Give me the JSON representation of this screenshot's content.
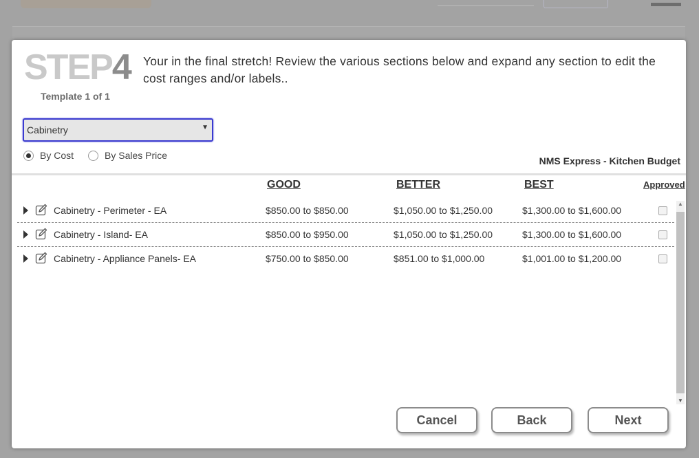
{
  "step": {
    "label": "STEP",
    "number": "4"
  },
  "template_info": "Template 1  of 1",
  "instructions": "Your in the final stretch!  Review the various sections below and expand any section to edit the cost ranges and/or labels..",
  "section_select": {
    "value": "Cabinetry"
  },
  "pricing_mode": [
    {
      "label": "By Cost",
      "selected": true
    },
    {
      "label": "By Sales Price",
      "selected": false
    }
  ],
  "budget_name": "NMS Express - Kitchen Budget",
  "columns": {
    "good": "GOOD",
    "better": "BETTER",
    "best": "BEST",
    "approved": "Approved"
  },
  "rows": [
    {
      "name": "Cabinetry - Perimeter - EA",
      "good": "$850.00 to $850.00",
      "better": "$1,050.00 to $1,250.00",
      "best": "$1,300.00 to $1,600.00",
      "approved": false
    },
    {
      "name": "Cabinetry - Island- EA",
      "good": "$850.00 to $950.00",
      "better": "$1,050.00 to $1,250.00",
      "best": "$1,300.00 to $1,600.00",
      "approved": false
    },
    {
      "name": "Cabinetry - Appliance Panels- EA",
      "good": "$750.00 to $850.00",
      "better": "$851.00 to $1,000.00",
      "best": "$1,001.00 to $1,200.00",
      "approved": false
    }
  ],
  "buttons": {
    "cancel": "Cancel",
    "back": "Back",
    "next": "Next"
  },
  "icons": {
    "expand": "caret-right-icon",
    "edit": "edit-icon",
    "select_caret": "triangle-down-icon"
  }
}
